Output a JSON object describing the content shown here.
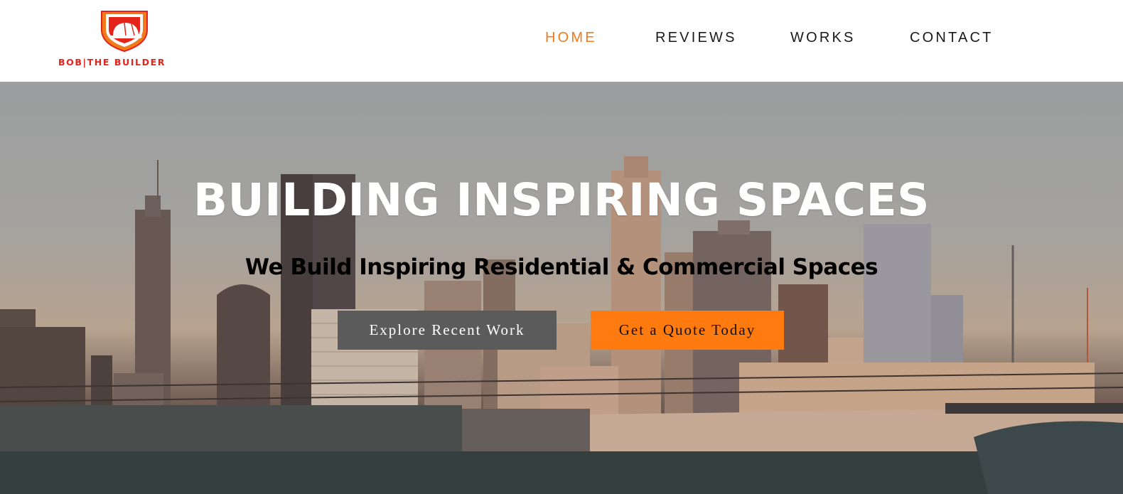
{
  "brand": {
    "logo_text": "BOB|THE BUILDER",
    "logo_icon": "hard-hat-shield-icon",
    "color_red": "#e5231b",
    "color_orange": "#f07a1c"
  },
  "nav": {
    "items": [
      {
        "label": "HOME",
        "active": true
      },
      {
        "label": "REVIEWS",
        "active": false
      },
      {
        "label": "WORKS",
        "active": false
      },
      {
        "label": "CONTACT",
        "active": false
      }
    ],
    "active_color": "#f07a1c"
  },
  "hero": {
    "title": "BUILDING INSPIRING SPACES",
    "subtitle": "We Build Inspiring Residential & Commercial Spaces",
    "buttons": {
      "explore": "Explore Recent Work",
      "quote": "Get a Quote Today"
    },
    "button_colors": {
      "explore": "#5b5b5b",
      "quote": "#ff7a0f"
    },
    "background_image": "city-skyline-photo"
  }
}
